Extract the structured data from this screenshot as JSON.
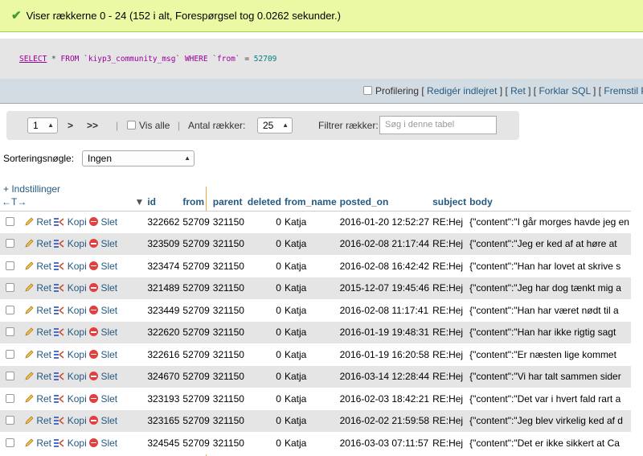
{
  "message": "Viser rækkerne 0 - 24 (152 i alt, Forespørgsel tog 0.0262 sekunder.)",
  "sql": {
    "select": "SELECT",
    "star": " * ",
    "from": "FROM",
    "table": " `kiyp3_community_msg` ",
    "where": "WHERE",
    "col": " `from` ",
    "eq": "= ",
    "value": "52709"
  },
  "toolbar": {
    "profiling": "Profilering",
    "edit_inline": "Redigér indlejret",
    "edit": "Ret",
    "explain": "Forklar SQL",
    "create_php": "Fremstil PHP-kode"
  },
  "nav": {
    "page": "1",
    "next": ">",
    "last": ">>",
    "show_all": "Vis alle",
    "rows_label": "Antal rækker:",
    "rows_value": "25",
    "filter_label": "Filtrer rækker:",
    "filter_placeholder": "Søg i denne tabel"
  },
  "sorting": {
    "label": "Sorteringsnøgle:",
    "value": "Ingen"
  },
  "options_link": "+ Indstillinger",
  "header_arrows": "←T→",
  "columns": [
    "id",
    "from",
    "parent",
    "deleted",
    "from_name",
    "posted_on",
    "subject",
    "body"
  ],
  "actions": {
    "edit": "Ret",
    "copy": "Kopi",
    "delete": "Slet"
  },
  "rows": [
    [
      "322662",
      "52709",
      "321150",
      "0",
      "Katja",
      "2016-01-20 12:52:27",
      "RE:Hej",
      "{\"content\":\"I går morges havde jeg en"
    ],
    [
      "323509",
      "52709",
      "321150",
      "0",
      "Katja",
      "2016-02-08 21:17:44",
      "RE:Hej",
      "{\"content\":\"Jeg er ked af at høre at"
    ],
    [
      "323474",
      "52709",
      "321150",
      "0",
      "Katja",
      "2016-02-08 16:42:42",
      "RE:Hej",
      "{\"content\":\"Han har lovet at skrive s"
    ],
    [
      "321489",
      "52709",
      "321150",
      "0",
      "Katja",
      "2015-12-07 19:45:46",
      "RE:Hej",
      "{\"content\":\"Jeg har dog tænkt mig a"
    ],
    [
      "323449",
      "52709",
      "321150",
      "0",
      "Katja",
      "2016-02-08 11:17:41",
      "RE:Hej",
      "{\"content\":\"Han har været nødt til a"
    ],
    [
      "322620",
      "52709",
      "321150",
      "0",
      "Katja",
      "2016-01-19 19:48:31",
      "RE:Hej",
      "{\"content\":\"Han har ikke rigtig sagt"
    ],
    [
      "322616",
      "52709",
      "321150",
      "0",
      "Katja",
      "2016-01-19 16:20:58",
      "RE:Hej",
      "{\"content\":\"Er næsten lige kommet"
    ],
    [
      "324670",
      "52709",
      "321150",
      "0",
      "Katja",
      "2016-03-14 12:28:44",
      "RE:Hej",
      "{\"content\":\"Vi har talt sammen sider"
    ],
    [
      "323193",
      "52709",
      "321150",
      "0",
      "Katja",
      "2016-02-03 18:42:21",
      "RE:Hej",
      "{\"content\":\"Det var i hvert fald rart a"
    ],
    [
      "323165",
      "52709",
      "321150",
      "0",
      "Katja",
      "2016-02-02 21:59:58",
      "RE:Hej",
      "{\"content\":\"Jeg blev virkelig ked af d"
    ],
    [
      "324545",
      "52709",
      "321150",
      "0",
      "Katja",
      "2016-03-03 07:11:57",
      "RE:Hej",
      "{\"content\":\"Det er ikke sikkert at Ca"
    ]
  ]
}
